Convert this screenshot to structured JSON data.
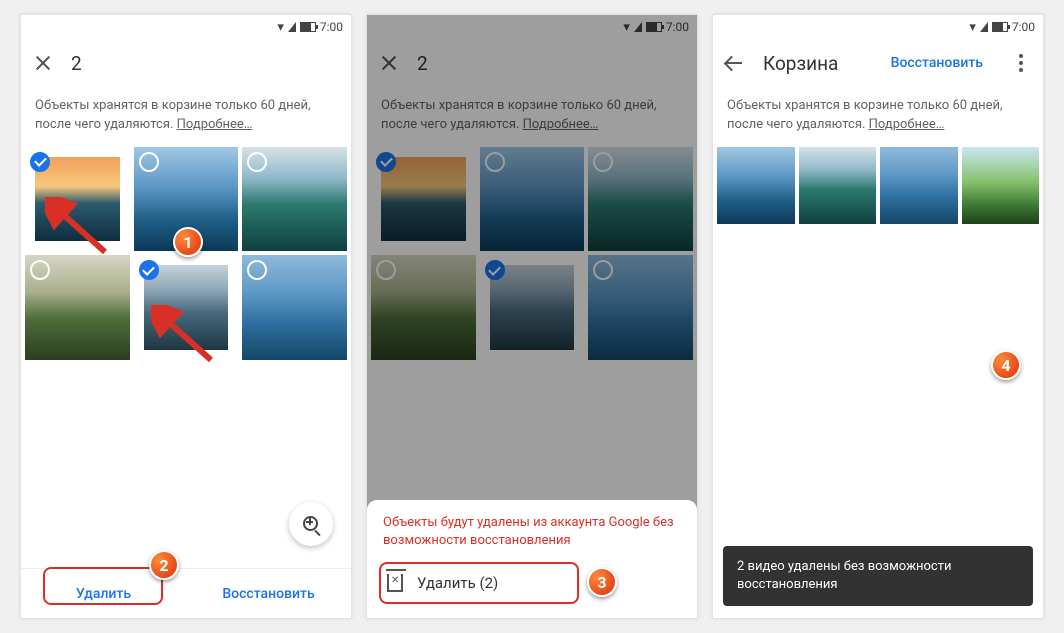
{
  "status": {
    "time": "7:00"
  },
  "screen1": {
    "count": "2",
    "notice_line1": "Объекты хранятся в корзине только 60 дней,",
    "notice_line2": "после чего удаляются.",
    "more": "Подробнее…",
    "delete": "Удалить",
    "restore": "Восстановить"
  },
  "screen2": {
    "count": "2",
    "notice_line1": "Объекты хранятся в корзине только 60 дней,",
    "notice_line2": "после чего удаляются.",
    "more": "Подробнее…",
    "sheet_warn": "Объекты будут удалены из аккаунта Google без возможности восстановления",
    "delete_count": "Удалить (2)"
  },
  "screen3": {
    "title": "Корзина",
    "restore": "Восстановить",
    "notice_line1": "Объекты хранятся в корзине только 60 дней,",
    "notice_line2": "после чего удаляются.",
    "more": "Подробнее…",
    "toast": "2 видео удалены без возможности восстановления"
  },
  "callouts": {
    "c1": "1",
    "c2": "2",
    "c3": "3",
    "c4": "4"
  }
}
